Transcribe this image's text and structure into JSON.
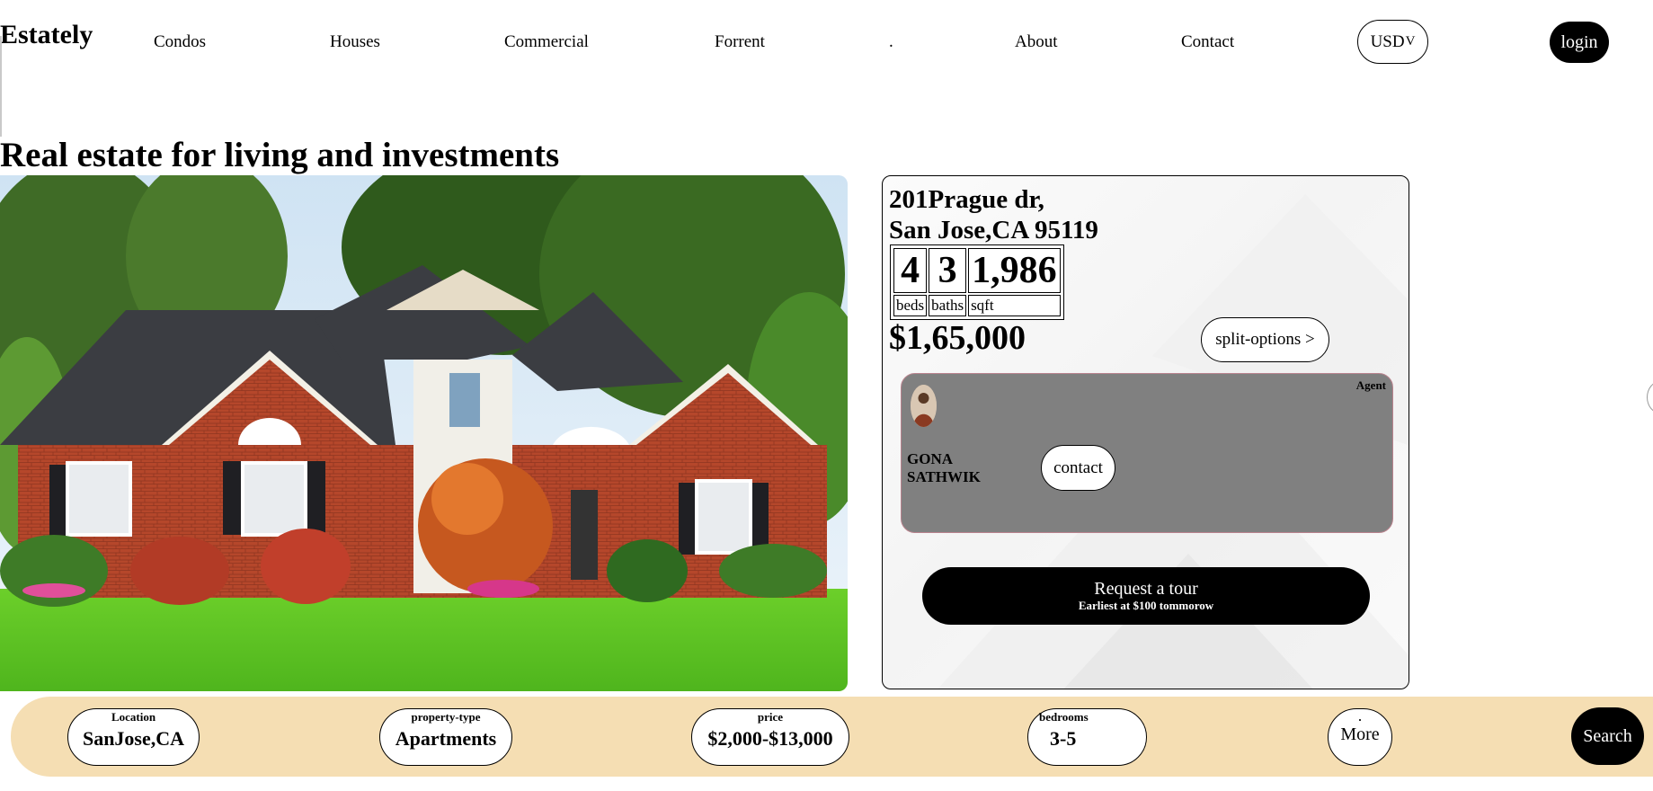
{
  "nav": {
    "brand": "Estately",
    "links": [
      "Condos",
      "Houses",
      "Commercial",
      "Forrent",
      "About",
      "Contact"
    ],
    "dot": ".",
    "currency": "USD",
    "currency_chevron": "V",
    "login": "login"
  },
  "hero": {
    "title": "Real estate for living and investments"
  },
  "listing": {
    "address_line1": "201Prague dr,",
    "address_line2": "San Jose,CA 95119",
    "beds": "4",
    "baths": "3",
    "sqft": "1,986",
    "beds_label": "beds",
    "baths_label": "baths",
    "sqft_label": "sqft",
    "price": "$1,65,000",
    "split_options": "split-options >",
    "agent": {
      "tag": "Agent",
      "name_line1": "GONA",
      "name_line2": "SATHWIK",
      "contact": "contact"
    },
    "tour": {
      "title": "Request a tour",
      "subtitle": "Earliest at $100 tommorow"
    }
  },
  "filters": {
    "location": {
      "caption": "Location",
      "value": "SanJose,CA"
    },
    "property_type": {
      "caption": "property-type",
      "value": "Apartments"
    },
    "price": {
      "caption": "price",
      "value": "$2,000-$13,000"
    },
    "bedrooms": {
      "caption": "bedrooms",
      "value": "3-5"
    },
    "more": {
      "caption": ".",
      "value": "More"
    },
    "search": "Search"
  },
  "colors": {
    "filter_bar": "#f5deb3",
    "agent_panel": "#808080",
    "primary": "#000000"
  },
  "icons": {
    "currency_dropdown": "chevron-down-icon"
  }
}
